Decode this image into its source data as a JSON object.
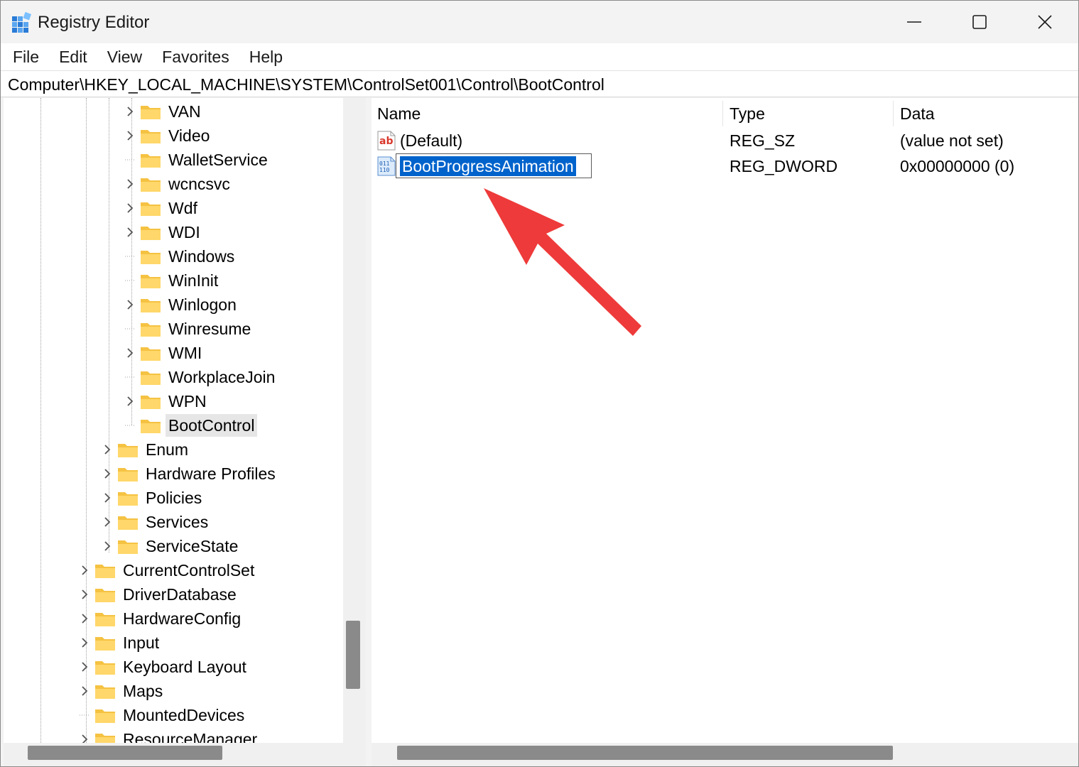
{
  "window": {
    "title": "Registry Editor",
    "icon": "registry-editor-icon"
  },
  "menu": {
    "items": [
      "File",
      "Edit",
      "View",
      "Favorites",
      "Help"
    ]
  },
  "address": {
    "path": "Computer\\HKEY_LOCAL_MACHINE\\SYSTEM\\ControlSet001\\Control\\BootControl"
  },
  "tree": {
    "nodes": [
      {
        "label": "VAN",
        "expandable": true
      },
      {
        "label": "Video",
        "expandable": true
      },
      {
        "label": "WalletService",
        "expandable": false
      },
      {
        "label": "wcncsvc",
        "expandable": true
      },
      {
        "label": "Wdf",
        "expandable": true
      },
      {
        "label": "WDI",
        "expandable": true
      },
      {
        "label": "Windows",
        "expandable": false
      },
      {
        "label": "WinInit",
        "expandable": false
      },
      {
        "label": "Winlogon",
        "expandable": true
      },
      {
        "label": "Winresume",
        "expandable": false
      },
      {
        "label": "WMI",
        "expandable": true
      },
      {
        "label": "WorkplaceJoin",
        "expandable": false
      },
      {
        "label": "WPN",
        "expandable": true
      },
      {
        "label": "BootControl",
        "expandable": false,
        "selected": true
      },
      {
        "label": "Enum",
        "expandable": true
      },
      {
        "label": "Hardware Profiles",
        "expandable": true
      },
      {
        "label": "Policies",
        "expandable": true
      },
      {
        "label": "Services",
        "expandable": true
      },
      {
        "label": "ServiceState",
        "expandable": true
      },
      {
        "label": "CurrentControlSet",
        "expandable": true
      },
      {
        "label": "DriverDatabase",
        "expandable": true
      },
      {
        "label": "HardwareConfig",
        "expandable": true
      },
      {
        "label": "Input",
        "expandable": true
      },
      {
        "label": "Keyboard Layout",
        "expandable": true
      },
      {
        "label": "Maps",
        "expandable": true
      },
      {
        "label": "MountedDevices",
        "expandable": false
      },
      {
        "label": "ResourceManager",
        "expandable": true
      }
    ]
  },
  "values": {
    "columns": [
      "Name",
      "Type",
      "Data"
    ],
    "rows": [
      {
        "name": "(Default)",
        "type": "REG_SZ",
        "data": "(value not set)",
        "icon": "string-value-icon"
      },
      {
        "name": "BootProgressAnimation",
        "type": "REG_DWORD",
        "data": "0x00000000 (0)",
        "icon": "binary-value-icon",
        "renaming": true
      }
    ]
  },
  "colors": {
    "selection": "#0063cc",
    "folder": "#f5c242",
    "annotation_arrow": "#ee3a3a"
  }
}
